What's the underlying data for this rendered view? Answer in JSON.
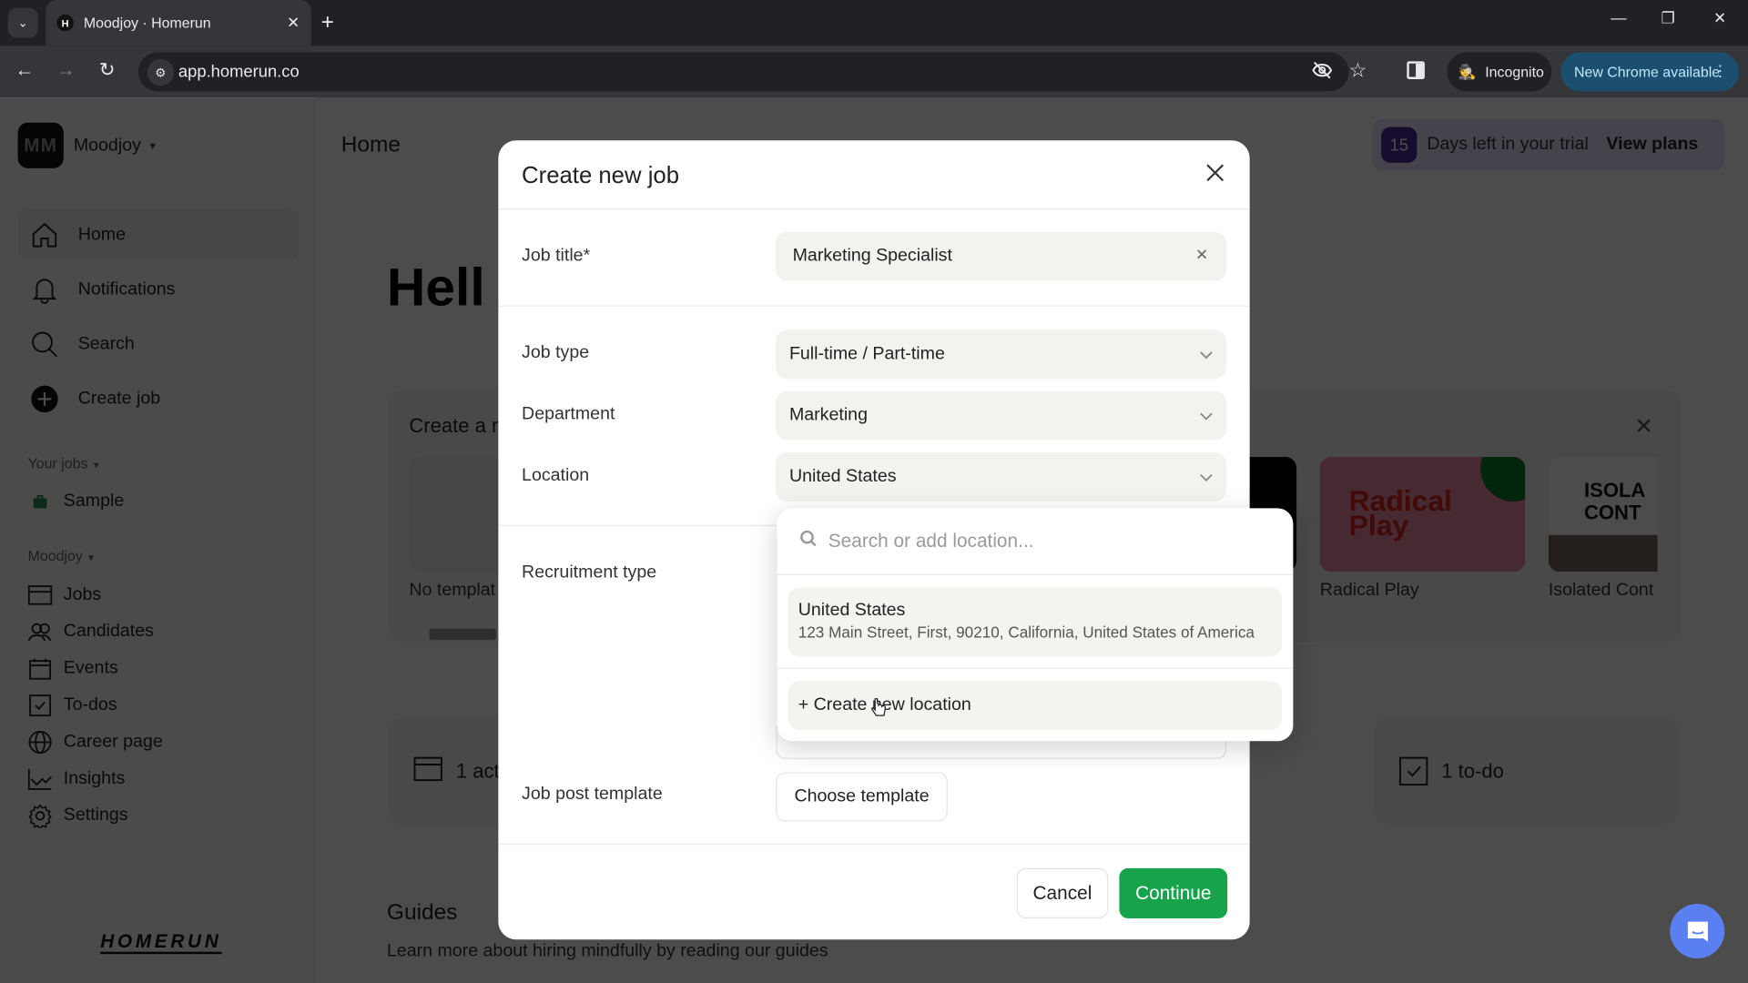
{
  "browser": {
    "tab_title": "Moodjoy · Homerun",
    "favicon_letter": "H",
    "url": "app.homerun.co",
    "incognito_label": "Incognito",
    "update_label": "New Chrome available"
  },
  "sidebar": {
    "org_initials": "MM",
    "org_name": "Moodjoy",
    "main_items": [
      {
        "label": "Home",
        "icon": "home-icon",
        "active": true
      },
      {
        "label": "Notifications",
        "icon": "bell-icon"
      },
      {
        "label": "Search",
        "icon": "search-icon"
      },
      {
        "label": "Create job",
        "icon": "plus-circle-icon"
      }
    ],
    "your_jobs_label": "Your jobs",
    "jobs": [
      {
        "label": "Sample",
        "icon": "briefcase-icon"
      }
    ],
    "org_section_label": "Moodjoy",
    "org_items": [
      {
        "label": "Jobs",
        "icon": "jobs-icon"
      },
      {
        "label": "Candidates",
        "icon": "candidates-icon"
      },
      {
        "label": "Events",
        "icon": "calendar-icon"
      },
      {
        "label": "To-dos",
        "icon": "checkbox-icon"
      },
      {
        "label": "Career page",
        "icon": "globe-icon"
      },
      {
        "label": "Insights",
        "icon": "chart-icon"
      },
      {
        "label": "Settings",
        "icon": "gear-icon"
      }
    ],
    "brand": "HOMERUN"
  },
  "main": {
    "page_title": "Home",
    "trial": {
      "days": "15",
      "text": "Days left in your trial",
      "cta": "View plans"
    },
    "greeting": "Hell",
    "templates": {
      "title": "Create a n",
      "items": [
        {
          "label": "No templat"
        },
        {
          "label": "Radical Play",
          "thumb_text": "Radical Play"
        },
        {
          "label": "Isolated Cont",
          "thumb_text": "ISOLA CONT"
        }
      ]
    },
    "stats": [
      {
        "label": "1 act",
        "icon": "jobs-icon"
      },
      {
        "label": "1 to-do",
        "icon": "checkbox-icon"
      }
    ],
    "guides": {
      "title": "Guides",
      "subtitle": "Learn more about hiring mindfully by reading our guides"
    }
  },
  "modal": {
    "title": "Create new job",
    "fields": {
      "job_title": {
        "label": "Job title*",
        "value": "Marketing Specialist"
      },
      "job_type": {
        "label": "Job type",
        "value": "Full-time / Part-time"
      },
      "department": {
        "label": "Department",
        "value": "Marketing"
      },
      "location": {
        "label": "Location",
        "value": "United States"
      },
      "recruitment_type": {
        "label": "Recruitment type"
      },
      "job_post_template": {
        "label": "Job post template",
        "button": "Choose template"
      }
    },
    "cancel_label": "Cancel",
    "continue_label": "Continue",
    "accent_color": "#17a34a"
  },
  "location_dropdown": {
    "search_placeholder": "Search or add location...",
    "options": [
      {
        "title": "United States",
        "subtitle": "123 Main Street, First, 90210, California, United States of America"
      }
    ],
    "create_label": "+ Create new location"
  }
}
